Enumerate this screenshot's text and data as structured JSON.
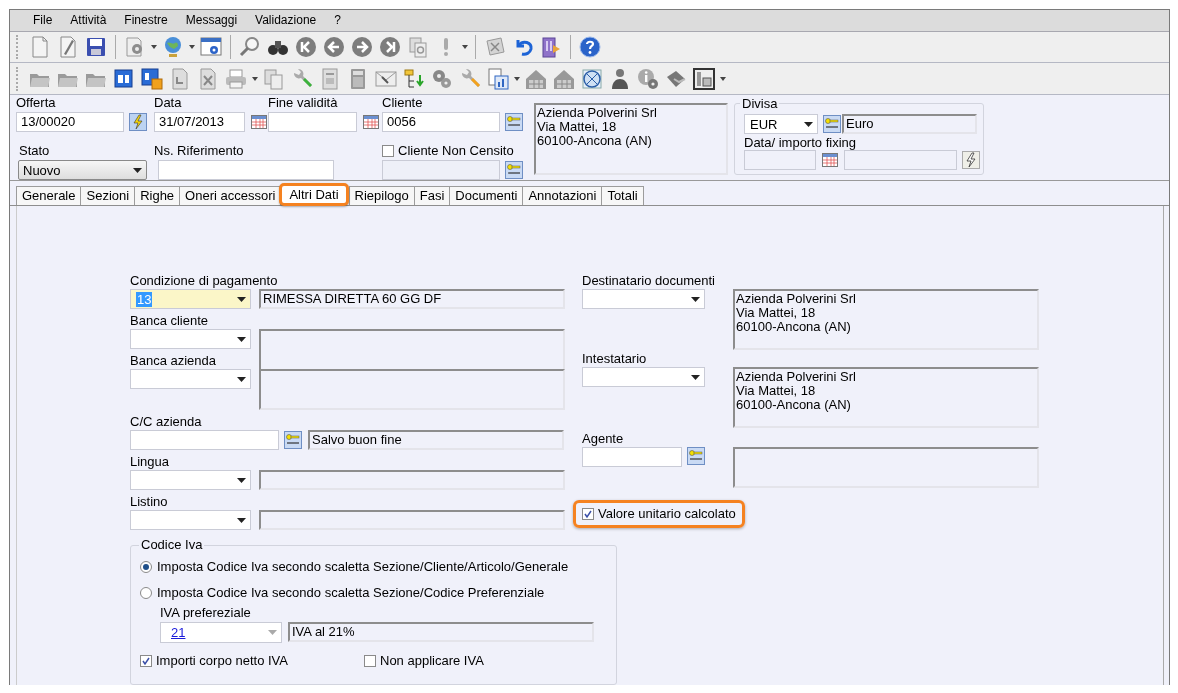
{
  "menu": [
    {
      "label": "File"
    },
    {
      "label": "Attività"
    },
    {
      "label": "Finestre"
    },
    {
      "label": "Messaggi"
    },
    {
      "label": "Validazione"
    },
    {
      "label": "?"
    }
  ],
  "header": {
    "offerta": {
      "label": "Offerta",
      "value": "13/00020"
    },
    "data": {
      "label": "Data",
      "value": "31/07/2013"
    },
    "fine_validita": {
      "label": "Fine validità"
    },
    "cliente": {
      "label": "Cliente",
      "value": "0056"
    },
    "cliente_non_censito": {
      "label": "Cliente Non Censito",
      "checked": false
    },
    "address": [
      "Azienda Polverini Srl",
      "Via Mattei, 18",
      "60100-Ancona (AN)"
    ],
    "stato": {
      "label": "Stato",
      "value": "Nuovo"
    },
    "ns_riferimento": {
      "label": "Ns. Riferimento"
    },
    "divisa": {
      "legend": "Divisa",
      "value": "EUR",
      "description": "Euro",
      "fixing_label": "Data/ importo fixing"
    }
  },
  "tabs": [
    {
      "label": "Generale",
      "selected": false,
      "highlighted": false
    },
    {
      "label": "Sezioni",
      "selected": false,
      "highlighted": false
    },
    {
      "label": "Righe",
      "selected": false,
      "highlighted": false
    },
    {
      "label": "Oneri accessori",
      "selected": false,
      "highlighted": false
    },
    {
      "label": "Altri Dati",
      "selected": true,
      "highlighted": true
    },
    {
      "label": "Riepilogo",
      "selected": false,
      "highlighted": false
    },
    {
      "label": "Fasi",
      "selected": false,
      "highlighted": false
    },
    {
      "label": "Documenti",
      "selected": false,
      "highlighted": false
    },
    {
      "label": "Annotazioni",
      "selected": false,
      "highlighted": false
    },
    {
      "label": "Totali",
      "selected": false,
      "highlighted": false
    }
  ],
  "left_fields": [
    {
      "kind": "combo",
      "label": "Condizione di pagamento",
      "value": "13",
      "description": "RIMESSA DIRETTA 60 GG DF",
      "focused": true
    },
    {
      "kind": "combo_tall",
      "label": "Banca cliente",
      "focused": false
    },
    {
      "kind": "combo_tall",
      "label": "Banca azienda",
      "focused": false
    },
    {
      "kind": "lookup",
      "label": "C/C azienda",
      "description": "Salvo buon fine",
      "focused": false
    },
    {
      "kind": "combo",
      "label": "Lingua",
      "focused": false
    },
    {
      "kind": "combo",
      "label": "Listino",
      "focused": false
    }
  ],
  "right_fields": [
    {
      "kind": "combo",
      "label": "Destinatario documenti",
      "address": [
        "Azienda Polverini Srl",
        "Via Mattei, 18",
        "60100-Ancona (AN)"
      ]
    },
    {
      "kind": "combo",
      "label": "Intestatario",
      "address": [
        "Azienda Polverini Srl",
        "Via Mattei, 18",
        "60100-Ancona (AN)"
      ]
    },
    {
      "kind": "lookup",
      "label": "Agente"
    }
  ],
  "valore_unitario": {
    "label": "Valore unitario calcolato",
    "checked": true,
    "highlighted": true
  },
  "codice_iva": {
    "legend": "Codice Iva",
    "options": [
      {
        "label": "Imposta Codice Iva secondo scaletta Sezione/Cliente/Articolo/Generale",
        "selected": true
      },
      {
        "label": "Imposta Codice Iva secondo scaletta Sezione/Codice Preferenziale",
        "selected": false
      }
    ],
    "iva_preferenziale": {
      "label": "IVA prefereziale",
      "value": "21",
      "description": "IVA al 21%",
      "disabled": true
    },
    "checks": [
      {
        "label": "Importi corpo netto IVA",
        "checked": true
      },
      {
        "label": "Non applicare IVA",
        "checked": false
      }
    ]
  }
}
